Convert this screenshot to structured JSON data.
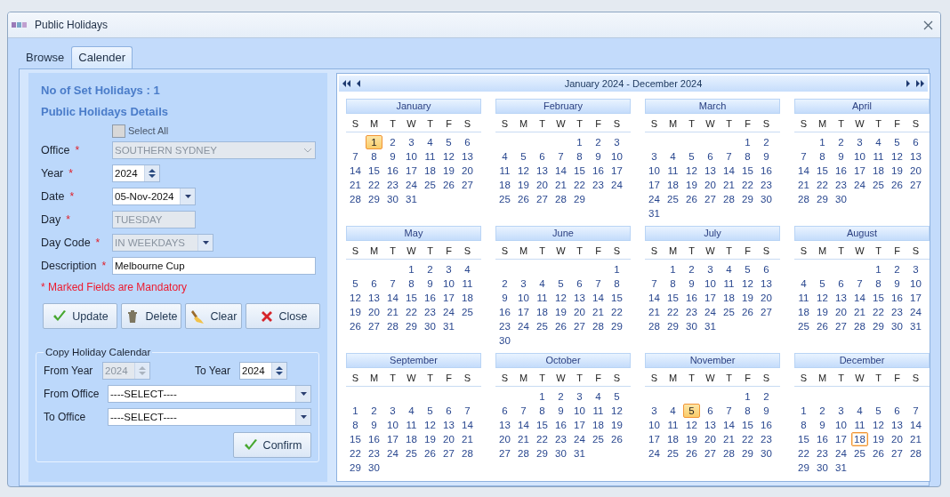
{
  "window": {
    "title": "Public Holidays"
  },
  "tabs": [
    {
      "label": "Browse",
      "selected": false
    },
    {
      "label": "Calender",
      "selected": true
    }
  ],
  "details": {
    "count_label": "No of Set Holidays : 1",
    "heading": "Public Holidays Details",
    "select_all": {
      "label": "Select All",
      "checked": false
    },
    "fields": [
      {
        "kind": "select",
        "label": "Office",
        "marker": "*",
        "value": "SOUTHERN SYDNEY",
        "disabled": true
      },
      {
        "kind": "spin",
        "label": "Year",
        "marker": "*",
        "value": "2024",
        "disabled": false
      },
      {
        "kind": "date",
        "label": "Date",
        "marker": "*",
        "value": "05-Nov-2024",
        "disabled": false
      },
      {
        "kind": "text",
        "label": "Day",
        "marker": "*",
        "value": "TUESDAY",
        "disabled": true
      },
      {
        "kind": "combo",
        "label": "Day Code",
        "marker": "*",
        "value": "IN WEEKDAYS",
        "disabled": true
      },
      {
        "kind": "text",
        "label": "Description",
        "marker": "*",
        "value": "Melbourne Cup",
        "disabled": false
      }
    ],
    "mandatory_note": "* Marked Fields are Mandatory",
    "actions": [
      {
        "kind": "check",
        "label": "Update"
      },
      {
        "kind": "trash",
        "label": "Delete"
      },
      {
        "kind": "broom",
        "label": "Clear"
      },
      {
        "kind": "cross",
        "label": "Close"
      }
    ]
  },
  "copy": {
    "title": "Copy Holiday Calendar",
    "from_year": {
      "label": "From Year",
      "value": "2024",
      "disabled": true
    },
    "to_year": {
      "label": "To Year",
      "value": "2024",
      "disabled": false
    },
    "from_office": {
      "label": "From Office",
      "value": "----SELECT----"
    },
    "to_office": {
      "label": "To Office",
      "value": "----SELECT----"
    },
    "confirm": "Confirm"
  },
  "calendar": {
    "range": "January 2024 - December 2024",
    "months": [
      {
        "name": "January",
        "weekdays": [
          "S",
          "M",
          "T",
          "W",
          "T",
          "F",
          "S"
        ],
        "blank_first_row": false,
        "weeks": [
          [
            {
              "label": "1",
              "holiday": true,
              "today": false
            },
            "2",
            "3",
            "4",
            "5",
            "6"
          ],
          [
            "7",
            "8",
            "9",
            "10",
            "11",
            "12",
            "13"
          ],
          [
            "14",
            "15",
            "16",
            "17",
            "18",
            "19",
            "20"
          ],
          [
            "21",
            "22",
            "23",
            "24",
            "25",
            "26",
            "27"
          ],
          [
            "28",
            "29",
            "30",
            "31"
          ]
        ]
      },
      {
        "name": "February",
        "weekdays": [
          "S",
          "M",
          "T",
          "W",
          "T",
          "F",
          "S"
        ],
        "blank_first_row": false,
        "weeks": [
          [
            "1",
            "2",
            "3"
          ],
          [
            "4",
            "5",
            "6",
            "7",
            "8",
            "9",
            "10"
          ],
          [
            "11",
            "12",
            "13",
            "14",
            "15",
            "16",
            "17"
          ],
          [
            "18",
            "19",
            "20",
            "21",
            "22",
            "23",
            "24"
          ],
          [
            "25",
            "26",
            "27",
            "28",
            "29"
          ]
        ]
      },
      {
        "name": "March",
        "weekdays": [
          "S",
          "M",
          "T",
          "W",
          "T",
          "F",
          "S"
        ],
        "blank_first_row": false,
        "weeks": [
          [
            "1",
            "2"
          ],
          [
            "3",
            "4",
            "5",
            "6",
            "7",
            "8",
            "9"
          ],
          [
            "10",
            "11",
            "12",
            "13",
            "14",
            "15",
            "16"
          ],
          [
            "17",
            "18",
            "19",
            "20",
            "21",
            "22",
            "23"
          ],
          [
            "24",
            "25",
            "26",
            "27",
            "28",
            "29",
            "30"
          ],
          [
            "31"
          ]
        ]
      },
      {
        "name": "April",
        "weekdays": [
          "S",
          "M",
          "T",
          "W",
          "T",
          "F",
          "S"
        ],
        "blank_first_row": false,
        "weeks": [
          [
            "1",
            "2",
            "3",
            "4",
            "5",
            "6"
          ],
          [
            "7",
            "8",
            "9",
            "10",
            "11",
            "12",
            "13"
          ],
          [
            "14",
            "15",
            "16",
            "17",
            "18",
            "19",
            "20"
          ],
          [
            "21",
            "22",
            "23",
            "24",
            "25",
            "26",
            "27"
          ],
          [
            "28",
            "29",
            "30"
          ]
        ]
      },
      {
        "name": "May",
        "weekdays": [
          "S",
          "M",
          "T",
          "W",
          "T",
          "F",
          "S"
        ],
        "blank_first_row": false,
        "weeks": [
          [
            "1",
            "2",
            "3",
            "4"
          ],
          [
            "5",
            "6",
            "7",
            "8",
            "9",
            "10",
            "11"
          ],
          [
            "12",
            "13",
            "14",
            "15",
            "16",
            "17",
            "18"
          ],
          [
            "19",
            "20",
            "21",
            "22",
            "23",
            "24",
            "25"
          ],
          [
            "26",
            "27",
            "28",
            "29",
            "30",
            "31"
          ]
        ]
      },
      {
        "name": "June",
        "weekdays": [
          "S",
          "M",
          "T",
          "W",
          "T",
          "F",
          "S"
        ],
        "blank_first_row": false,
        "weeks": [
          [
            "1"
          ],
          [
            "2",
            "3",
            "4",
            "5",
            "6",
            "7",
            "8"
          ],
          [
            "9",
            "10",
            "11",
            "12",
            "13",
            "14",
            "15"
          ],
          [
            "16",
            "17",
            "18",
            "19",
            "20",
            "21",
            "22"
          ],
          [
            "23",
            "24",
            "25",
            "26",
            "27",
            "28",
            "29"
          ],
          [
            "30"
          ]
        ]
      },
      {
        "name": "July",
        "weekdays": [
          "S",
          "M",
          "T",
          "W",
          "T",
          "F",
          "S"
        ],
        "blank_first_row": false,
        "weeks": [
          [
            "1",
            "2",
            "3",
            "4",
            "5",
            "6"
          ],
          [
            "7",
            "8",
            "9",
            "10",
            "11",
            "12",
            "13"
          ],
          [
            "14",
            "15",
            "16",
            "17",
            "18",
            "19",
            "20"
          ],
          [
            "21",
            "22",
            "23",
            "24",
            "25",
            "26",
            "27"
          ],
          [
            "28",
            "29",
            "30",
            "31"
          ]
        ]
      },
      {
        "name": "August",
        "weekdays": [
          "S",
          "M",
          "T",
          "W",
          "T",
          "F",
          "S"
        ],
        "blank_first_row": false,
        "weeks": [
          [
            "1",
            "2",
            "3"
          ],
          [
            "4",
            "5",
            "6",
            "7",
            "8",
            "9",
            "10"
          ],
          [
            "11",
            "12",
            "13",
            "14",
            "15",
            "16",
            "17"
          ],
          [
            "18",
            "19",
            "20",
            "21",
            "22",
            "23",
            "24"
          ],
          [
            "25",
            "26",
            "27",
            "28",
            "29",
            "30",
            "31"
          ]
        ]
      },
      {
        "name": "September",
        "weekdays": [
          "S",
          "M",
          "T",
          "W",
          "T",
          "F",
          "S"
        ],
        "blank_first_row": true,
        "weeks": [
          [
            "1",
            "2",
            "3",
            "4",
            "5",
            "6",
            "7"
          ],
          [
            "8",
            "9",
            "10",
            "11",
            "12",
            "13",
            "14"
          ],
          [
            "15",
            "16",
            "17",
            "18",
            "19",
            "20",
            "21"
          ],
          [
            "22",
            "23",
            "24",
            "25",
            "26",
            "27",
            "28"
          ],
          [
            "29",
            "30"
          ]
        ]
      },
      {
        "name": "October",
        "weekdays": [
          "S",
          "M",
          "T",
          "W",
          "T",
          "F",
          "S"
        ],
        "blank_first_row": false,
        "weeks": [
          [
            "1",
            "2",
            "3",
            "4",
            "5"
          ],
          [
            "6",
            "7",
            "8",
            "9",
            "10",
            "11",
            "12"
          ],
          [
            "13",
            "14",
            "15",
            "16",
            "17",
            "18",
            "19"
          ],
          [
            "20",
            "21",
            "22",
            "23",
            "24",
            "25",
            "26"
          ],
          [
            "27",
            "28",
            "29",
            "30",
            "31"
          ]
        ]
      },
      {
        "name": "November",
        "weekdays": [
          "S",
          "M",
          "T",
          "W",
          "T",
          "F",
          "S"
        ],
        "blank_first_row": false,
        "weeks": [
          [
            "1",
            "2"
          ],
          [
            "3",
            "4",
            {
              "label": "5",
              "holiday": true,
              "today": false
            },
            "6",
            "7",
            "8",
            "9"
          ],
          [
            "10",
            "11",
            "12",
            "13",
            "14",
            "15",
            "16"
          ],
          [
            "17",
            "18",
            "19",
            "20",
            "21",
            "22",
            "23"
          ],
          [
            "24",
            "25",
            "26",
            "27",
            "28",
            "29",
            "30"
          ]
        ]
      },
      {
        "name": "December",
        "weekdays": [
          "S",
          "M",
          "T",
          "W",
          "T",
          "F",
          "S"
        ],
        "blank_first_row": true,
        "weeks": [
          [
            "1",
            "2",
            "3",
            "4",
            "5",
            "6",
            "7"
          ],
          [
            "8",
            "9",
            "10",
            "11",
            "12",
            "13",
            "14"
          ],
          [
            "15",
            "16",
            "17",
            {
              "label": "18",
              "holiday": false,
              "today": true
            },
            "19",
            "20",
            "21"
          ],
          [
            "22",
            "23",
            "24",
            "25",
            "26",
            "27",
            "28"
          ],
          [
            "29",
            "30",
            "31"
          ]
        ]
      }
    ]
  }
}
